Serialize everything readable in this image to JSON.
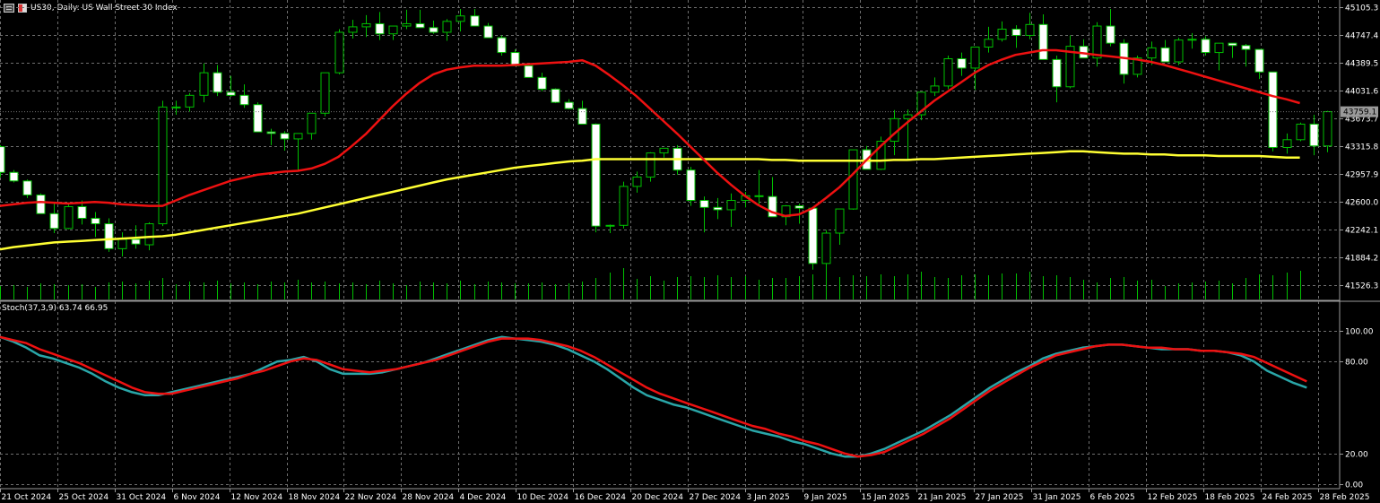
{
  "header": {
    "title": "US30, Daily:  US Wall Street 30 Index",
    "menu_icon": "window-menu-icon",
    "symbol_icon": "symbol-properties-icon"
  },
  "chart_data": [
    {
      "type": "candlestick",
      "title": "US30, Daily:  US Wall Street 30 Index",
      "ylim": [
        41347.4,
        45194.6
      ],
      "y_ticks": [
        "45105.3",
        "44747.4",
        "44389.5",
        "44031.6",
        "43673.7",
        "43315.8",
        "42957.9",
        "42600.0",
        "42242.1",
        "41884.2",
        "41526.3"
      ],
      "current_price_label": "43759.1",
      "x_labels": [
        "21 Oct 2024",
        "25 Oct 2024",
        "31 Oct 2024",
        "6 Nov 2024",
        "12 Nov 2024",
        "18 Nov 2024",
        "22 Nov 2024",
        "28 Nov 2024",
        "4 Dec 2024",
        "10 Dec 2024",
        "16 Dec 2024",
        "20 Dec 2024",
        "27 Dec 2024",
        "3 Jan 2025",
        "9 Jan 2025",
        "15 Jan 2025",
        "21 Jan 2025",
        "27 Jan 2025",
        "31 Jan 2025",
        "6 Feb 2025",
        "12 Feb 2025",
        "18 Feb 2025",
        "24 Feb 2025",
        "28 Feb 2025"
      ],
      "grid": true,
      "colors": {
        "bull_body": "#000000",
        "bear_body": "#ffffff",
        "wick": "#00c000",
        "volume": "#00c000",
        "background": "#000000",
        "grid": "#6f6f6f",
        "ma_fast": "#ee1111",
        "ma_slow": "#ffff33"
      },
      "ohlc": [
        [
          43310,
          43330,
          42920,
          42980
        ],
        [
          42980,
          43010,
          42850,
          42870
        ],
        [
          42870,
          42890,
          42650,
          42690
        ],
        [
          42690,
          42710,
          42490,
          42450
        ],
        [
          42450,
          42600,
          42200,
          42260
        ],
        [
          42260,
          42580,
          42250,
          42540
        ],
        [
          42540,
          42620,
          42310,
          42390
        ],
        [
          42390,
          42470,
          42150,
          42320
        ],
        [
          42320,
          42390,
          41960,
          42000
        ],
        [
          42000,
          42210,
          41900,
          42120
        ],
        [
          42120,
          42300,
          42000,
          42060
        ],
        [
          42050,
          42340,
          41980,
          42320
        ],
        [
          42320,
          43900,
          42290,
          43820
        ],
        [
          43820,
          43900,
          43720,
          43820
        ],
        [
          43820,
          44000,
          43760,
          43970
        ],
        [
          43970,
          44380,
          43880,
          44260
        ],
        [
          44260,
          44360,
          43960,
          44010
        ],
        [
          44010,
          44220,
          43950,
          43970
        ],
        [
          43970,
          44110,
          43810,
          43850
        ],
        [
          43850,
          43880,
          43630,
          43500
        ],
        [
          43500,
          43540,
          43330,
          43480
        ],
        [
          43480,
          43510,
          43260,
          43410
        ],
        [
          43410,
          43450,
          43000,
          43480
        ],
        [
          43480,
          43720,
          43400,
          43740
        ],
        [
          43740,
          44040,
          43700,
          44260
        ],
        [
          44260,
          44820,
          44240,
          44780
        ],
        [
          44780,
          44940,
          44700,
          44850
        ],
        [
          44850,
          45000,
          44720,
          44890
        ],
        [
          44890,
          45040,
          44680,
          44760
        ],
        [
          44760,
          44860,
          44680,
          44860
        ],
        [
          44860,
          45070,
          44820,
          44890
        ],
        [
          44890,
          45070,
          44840,
          44840
        ],
        [
          44840,
          44930,
          44760,
          44780
        ],
        [
          44780,
          44950,
          44670,
          44920
        ],
        [
          44920,
          45080,
          44790,
          44990
        ],
        [
          44990,
          45080,
          44870,
          44860
        ],
        [
          44860,
          44900,
          44720,
          44710
        ],
        [
          44710,
          44740,
          44480,
          44520
        ],
        [
          44520,
          44560,
          44380,
          44350
        ],
        [
          44350,
          44380,
          44200,
          44200
        ],
        [
          44200,
          44260,
          44020,
          44050
        ],
        [
          44050,
          44060,
          43870,
          43880
        ],
        [
          43880,
          43920,
          43790,
          43800
        ],
        [
          43800,
          43900,
          43650,
          43600
        ],
        [
          43600,
          43610,
          42210,
          42290
        ],
        [
          42290,
          42310,
          42200,
          42300
        ],
        [
          42300,
          42860,
          42260,
          42800
        ],
        [
          42800,
          42990,
          42720,
          42920
        ],
        [
          42920,
          43240,
          42860,
          43230
        ],
        [
          43230,
          43280,
          43170,
          43290
        ],
        [
          43290,
          43330,
          42950,
          43010
        ],
        [
          43010,
          43050,
          42550,
          42620
        ],
        [
          42620,
          42670,
          42210,
          42530
        ],
        [
          42530,
          42650,
          42380,
          42500
        ],
        [
          42500,
          42710,
          42280,
          42620
        ],
        [
          42620,
          42730,
          42530,
          42680
        ],
        [
          42680,
          43010,
          42550,
          42670
        ],
        [
          42670,
          42920,
          42450,
          42410
        ],
        [
          42410,
          42560,
          42300,
          42550
        ],
        [
          42550,
          42580,
          42320,
          42520
        ],
        [
          42520,
          42540,
          41730,
          41810
        ],
        [
          41810,
          42240,
          41620,
          42200
        ],
        [
          42200,
          42470,
          42050,
          42510
        ],
        [
          42510,
          43200,
          42500,
          43270
        ],
        [
          43270,
          43320,
          43050,
          43020
        ],
        [
          43020,
          43440,
          43010,
          43380
        ],
        [
          43380,
          43780,
          43200,
          43670
        ],
        [
          43670,
          43790,
          43150,
          43720
        ],
        [
          43720,
          43990,
          43650,
          44010
        ],
        [
          44010,
          44200,
          43960,
          44090
        ],
        [
          44090,
          44480,
          44050,
          44440
        ],
        [
          44440,
          44520,
          44220,
          44320
        ],
        [
          44320,
          44540,
          44040,
          44590
        ],
        [
          44590,
          44850,
          44520,
          44690
        ],
        [
          44690,
          44920,
          44660,
          44820
        ],
        [
          44820,
          44870,
          44580,
          44740
        ],
        [
          44740,
          45030,
          44690,
          44880
        ],
        [
          44880,
          45010,
          44460,
          44430
        ],
        [
          44430,
          44480,
          43880,
          44080
        ],
        [
          44080,
          44740,
          44060,
          44600
        ],
        [
          44600,
          44690,
          44490,
          44450
        ],
        [
          44450,
          44910,
          44340,
          44860
        ],
        [
          44860,
          45080,
          44600,
          44640
        ],
        [
          44640,
          44690,
          44120,
          44240
        ],
        [
          44240,
          44480,
          44200,
          44450
        ],
        [
          44450,
          44660,
          44360,
          44580
        ],
        [
          44580,
          44680,
          44450,
          44400
        ],
        [
          44400,
          44710,
          44360,
          44680
        ],
        [
          44680,
          44770,
          44570,
          44690
        ],
        [
          44690,
          44730,
          44480,
          44520
        ],
        [
          44520,
          44630,
          44290,
          44640
        ],
        [
          44640,
          44640,
          44450,
          44610
        ],
        [
          44610,
          44630,
          44340,
          44560
        ],
        [
          44560,
          44560,
          44180,
          44270
        ],
        [
          44270,
          44270,
          43250,
          43300
        ],
        [
          43300,
          43480,
          43220,
          43400
        ],
        [
          43400,
          43620,
          43380,
          43600
        ],
        [
          43600,
          43720,
          43200,
          43320
        ],
        [
          43320,
          43770,
          43240,
          43760
        ]
      ],
      "volume": [
        15,
        16,
        14,
        18,
        17,
        16,
        17,
        14,
        19,
        20,
        18,
        21,
        24,
        17,
        20,
        19,
        21,
        18,
        19,
        17,
        20,
        19,
        22,
        19,
        20,
        18,
        19,
        17,
        21,
        18,
        16,
        20,
        19,
        18,
        21,
        17,
        20,
        19,
        18,
        18,
        19,
        17,
        18,
        20,
        24,
        30,
        35,
        23,
        26,
        21,
        25,
        26,
        25,
        27,
        25,
        26,
        22,
        24,
        24,
        26,
        28,
        24,
        25,
        27,
        26,
        28,
        26,
        28,
        31,
        25,
        24,
        27,
        28,
        27,
        29,
        29,
        31,
        26,
        27,
        25,
        22,
        19,
        24,
        25,
        21,
        22,
        15,
        18,
        19,
        20,
        21,
        18,
        24,
        28,
        27,
        30,
        32
      ],
      "ma_fast": [
        42550,
        42570,
        42590,
        42600,
        42590,
        42580,
        42590,
        42600,
        42590,
        42570,
        42560,
        42550,
        42550,
        42620,
        42690,
        42750,
        42810,
        42870,
        42910,
        42950,
        42970,
        42990,
        43000,
        43030,
        43090,
        43180,
        43320,
        43470,
        43650,
        43830,
        43990,
        44130,
        44240,
        44300,
        44330,
        44350,
        44350,
        44350,
        44360,
        44370,
        44380,
        44390,
        44400,
        44420,
        44350,
        44230,
        44100,
        43960,
        43800,
        43640,
        43480,
        43310,
        43140,
        42970,
        42820,
        42680,
        42560,
        42470,
        42420,
        42440,
        42520,
        42650,
        42790,
        42960,
        43140,
        43310,
        43470,
        43620,
        43760,
        43900,
        44020,
        44140,
        44260,
        44360,
        44430,
        44490,
        44520,
        44550,
        44550,
        44530,
        44510,
        44490,
        44470,
        44450,
        44430,
        44400,
        44360,
        44310,
        44260,
        44210,
        44160,
        44110,
        44060,
        44010,
        43960,
        43920,
        43870
      ],
      "ma_slow": [
        41990,
        42020,
        42040,
        42060,
        42080,
        42090,
        42100,
        42110,
        42120,
        42130,
        42140,
        42150,
        42160,
        42180,
        42210,
        42240,
        42270,
        42300,
        42330,
        42360,
        42390,
        42420,
        42450,
        42490,
        42530,
        42570,
        42610,
        42650,
        42690,
        42730,
        42770,
        42810,
        42850,
        42890,
        42920,
        42950,
        42980,
        43010,
        43040,
        43060,
        43080,
        43100,
        43120,
        43130,
        43150,
        43150,
        43150,
        43150,
        43150,
        43150,
        43150,
        43150,
        43150,
        43150,
        43150,
        43150,
        43150,
        43140,
        43140,
        43130,
        43130,
        43130,
        43130,
        43130,
        43130,
        43130,
        43140,
        43140,
        43150,
        43150,
        43160,
        43170,
        43180,
        43190,
        43200,
        43210,
        43220,
        43230,
        43240,
        43250,
        43250,
        43240,
        43230,
        43220,
        43220,
        43210,
        43210,
        43200,
        43200,
        43200,
        43190,
        43190,
        43190,
        43190,
        43180,
        43170,
        43170
      ]
    },
    {
      "type": "line",
      "title": "Stoch(37,3,9) 63.74 66.95",
      "ylim": [
        0,
        100
      ],
      "y_ticks": [
        "100.00",
        "80.00",
        "20.00",
        "0.00"
      ],
      "series": [
        {
          "name": "Main",
          "color": "#2aa6a8",
          "values": [
            96,
            93,
            89,
            84,
            82,
            79,
            76,
            72,
            67,
            63,
            60,
            58,
            58,
            60,
            62,
            64,
            66,
            68,
            70,
            72,
            76,
            80,
            81,
            83,
            80,
            75,
            72,
            72,
            72,
            73,
            75,
            77,
            79,
            82,
            85,
            88,
            91,
            94,
            96,
            95,
            94,
            93,
            91,
            88,
            84,
            80,
            75,
            69,
            63,
            58,
            55,
            52,
            50,
            47,
            44,
            41,
            38,
            35,
            33,
            31,
            28,
            26,
            23,
            20,
            18,
            18,
            20,
            23,
            27,
            31,
            35,
            40,
            45,
            51,
            57,
            63,
            68,
            73,
            77,
            82,
            85,
            87,
            89,
            90,
            91,
            91,
            90,
            89,
            88,
            88,
            88,
            87,
            87,
            86,
            84,
            80,
            74,
            70,
            66,
            63
          ]
        },
        {
          "name": "Signal",
          "color": "#ee1111",
          "values": [
            96,
            94,
            92,
            88,
            85,
            82,
            79,
            75,
            71,
            67,
            63,
            60,
            59,
            59,
            61,
            63,
            65,
            67,
            69,
            72,
            74,
            77,
            80,
            82,
            81,
            78,
            75,
            74,
            73,
            74,
            75,
            77,
            79,
            81,
            84,
            87,
            90,
            93,
            95,
            95,
            95,
            94,
            92,
            90,
            87,
            83,
            78,
            73,
            68,
            63,
            59,
            56,
            53,
            50,
            47,
            44,
            41,
            38,
            36,
            33,
            31,
            28,
            26,
            23,
            20,
            18,
            19,
            21,
            25,
            29,
            33,
            38,
            43,
            49,
            55,
            61,
            66,
            71,
            76,
            80,
            84,
            86,
            88,
            90,
            91,
            91,
            90,
            89,
            89,
            88,
            88,
            87,
            87,
            86,
            85,
            83,
            79,
            75,
            71,
            67
          ]
        }
      ]
    }
  ]
}
